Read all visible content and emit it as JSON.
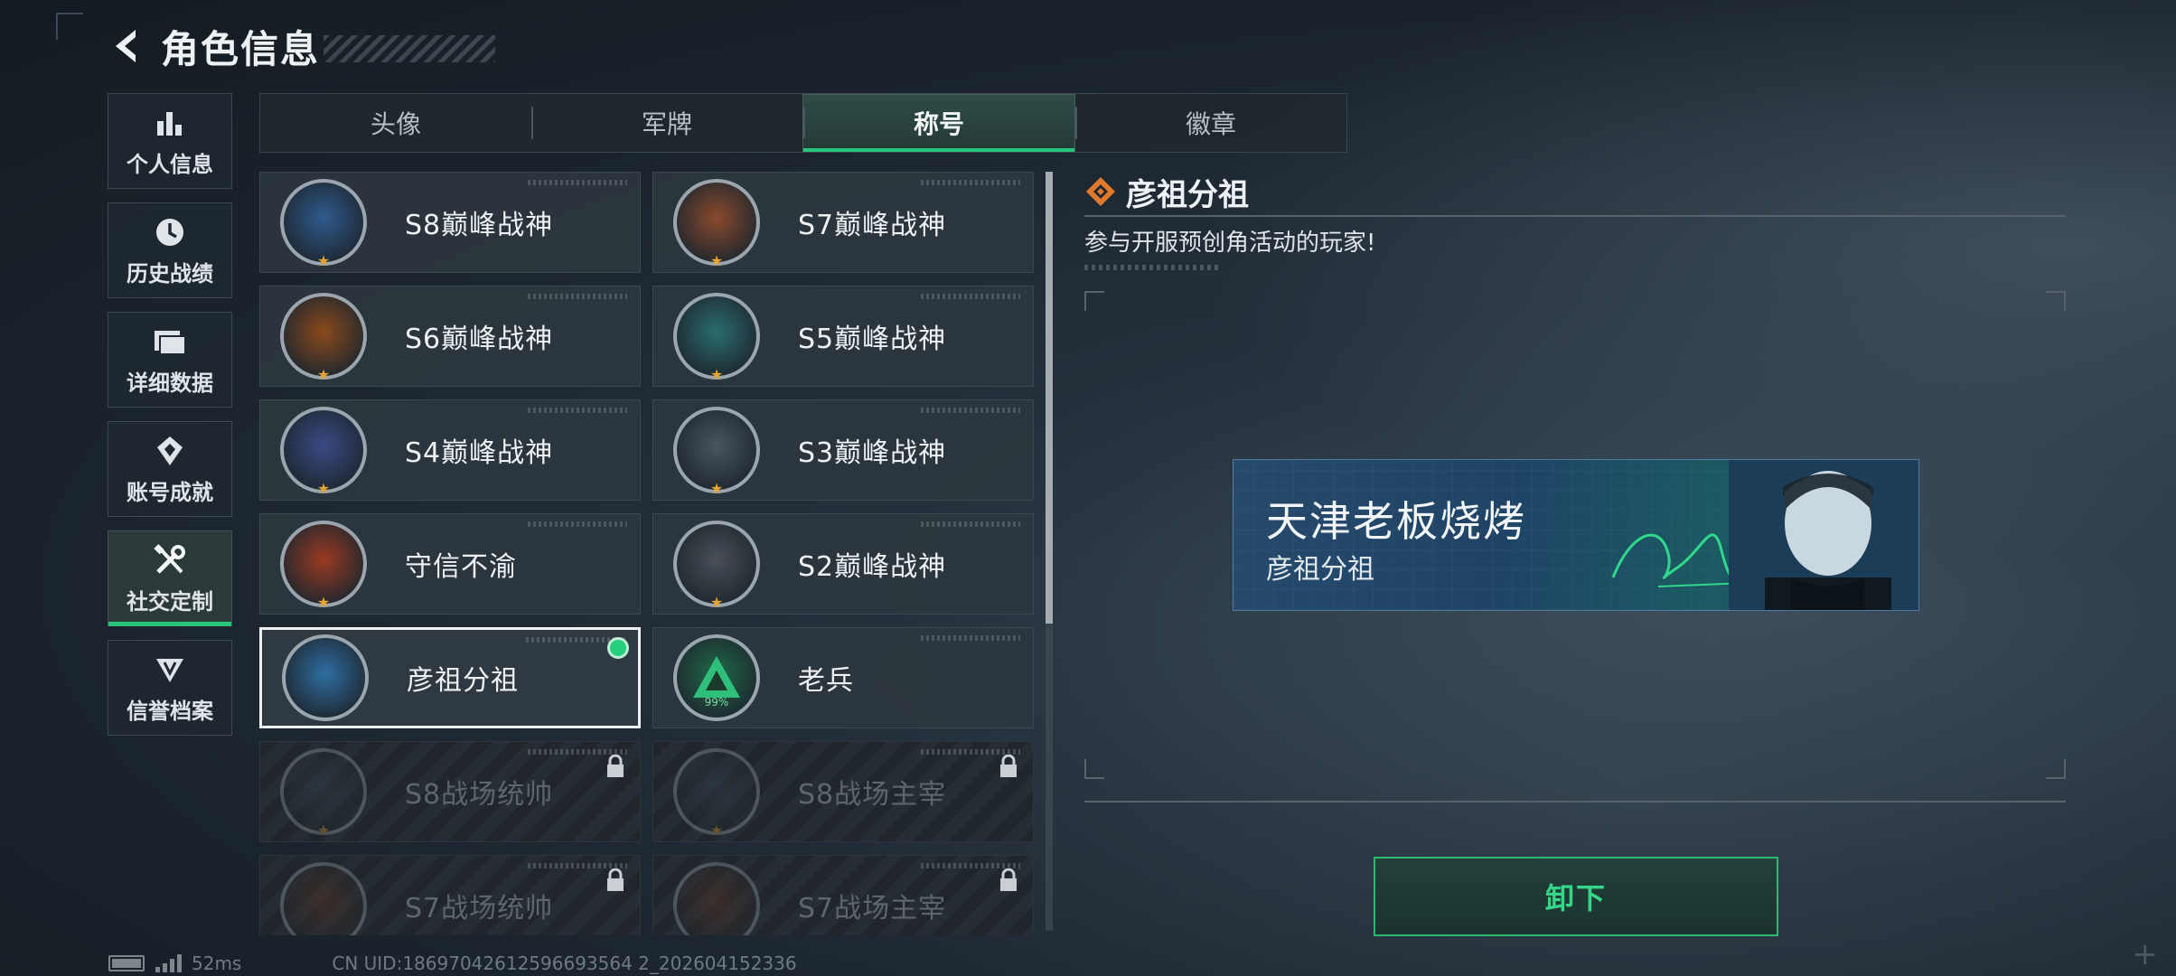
{
  "header": {
    "title": "角色信息"
  },
  "sidebar": {
    "items": [
      {
        "label": "个人信息",
        "icon": "bar-chart-icon",
        "active": false
      },
      {
        "label": "历史战绩",
        "icon": "clock-icon",
        "active": false
      },
      {
        "label": "详细数据",
        "icon": "folder-icon",
        "active": false
      },
      {
        "label": "账号成就",
        "icon": "achievement-icon",
        "active": false
      },
      {
        "label": "社交定制",
        "icon": "tools-icon",
        "active": true
      },
      {
        "label": "信誉档案",
        "icon": "shield-emblem-icon",
        "active": false
      }
    ]
  },
  "tabs": [
    {
      "label": "头像",
      "active": false
    },
    {
      "label": "军牌",
      "active": false
    },
    {
      "label": "称号",
      "active": true
    },
    {
      "label": "徽章",
      "active": false
    }
  ],
  "titles": [
    {
      "label": "S8巅峰战神",
      "emblem": "hex-stripes-emblem",
      "color": "#2f5b8f",
      "state": "owned"
    },
    {
      "label": "S7巅峰战神",
      "emblem": "rifle-emblem",
      "color": "#8a4a2c",
      "state": "owned"
    },
    {
      "label": "S6巅峰战神",
      "emblem": "t-shield-emblem",
      "color": "#8a4a1c",
      "state": "owned"
    },
    {
      "label": "S5巅峰战神",
      "emblem": "diver-skull-emblem",
      "color": "#2a6d70",
      "state": "owned"
    },
    {
      "label": "S4巅峰战神",
      "emblem": "helmet-emblem",
      "color": "#3a4b86",
      "state": "owned"
    },
    {
      "label": "S3巅峰战神",
      "emblem": "globe-emblem",
      "color": "#4a5560",
      "state": "owned"
    },
    {
      "label": "守信不渝",
      "emblem": "scales-emblem",
      "color": "#9a3a22",
      "state": "owned"
    },
    {
      "label": "S2巅峰战神",
      "emblem": "pyramid-emblem",
      "color": "#4a4f58",
      "state": "owned"
    },
    {
      "label": "彦祖分祖",
      "emblem": "portrait-emblem",
      "color": "#2f6ea3",
      "state": "equipped"
    },
    {
      "label": "老兵",
      "emblem": "veteran-emblem",
      "color": "#1f6b48",
      "state": "owned",
      "percent": "99%"
    },
    {
      "label": "S8战场统帅",
      "emblem": "tank-emblem",
      "color": "#3b4a55",
      "state": "locked"
    },
    {
      "label": "S8战场主宰",
      "emblem": "building-emblem",
      "color": "#3b4a55",
      "state": "locked"
    },
    {
      "label": "S7战场统帅",
      "emblem": "vehicle-emblem",
      "color": "#6b3a22",
      "state": "locked"
    },
    {
      "label": "S7战场主宰",
      "emblem": "face-emblem",
      "color": "#6b3a22",
      "state": "locked"
    }
  ],
  "detail": {
    "title": "彦祖分祖",
    "description": "参与开服预创角活动的玩家!",
    "nameplate": {
      "player_name": "天津老板烧烤",
      "title": "彦祖分祖"
    },
    "unequip_label": "卸下"
  },
  "status_bar": {
    "ping": "52ms",
    "uid": "CN UID:18697042612596693564 2_202604152336"
  },
  "colors": {
    "accent_green": "#27c47b",
    "orange_diamond": "#e07a2a"
  }
}
